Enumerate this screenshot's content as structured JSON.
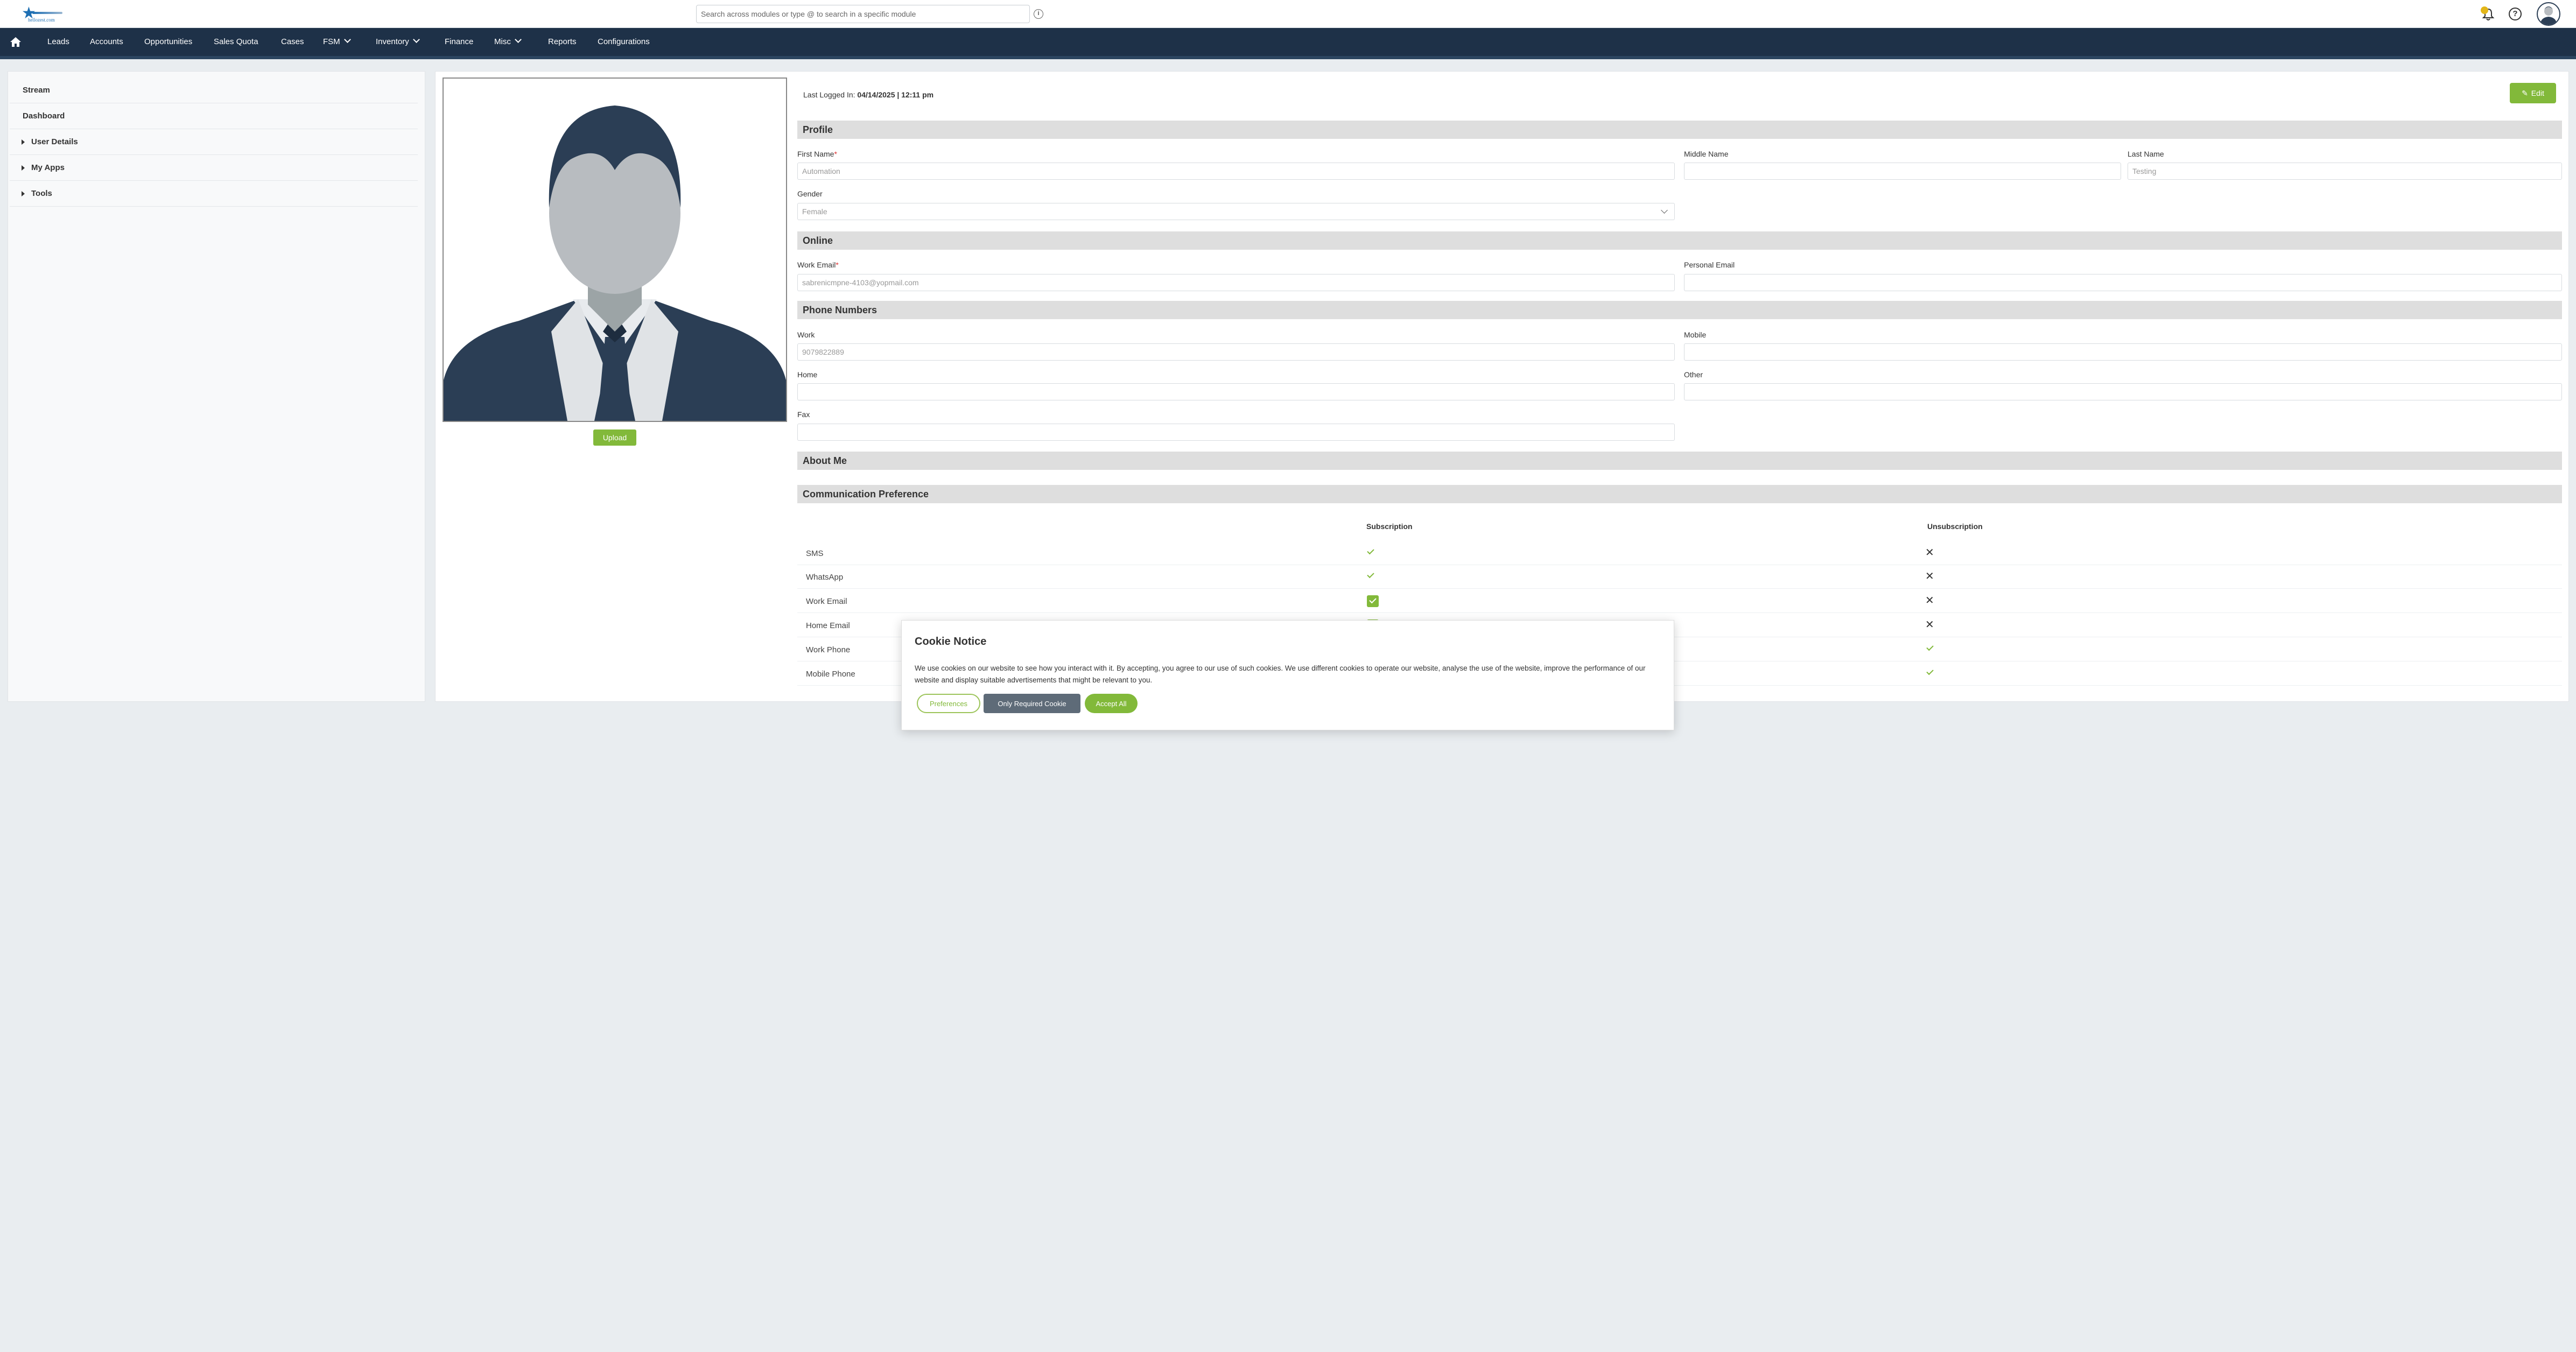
{
  "topbar": {
    "logo_text": "hellozest.com",
    "search_placeholder": "Search across modules or type @ to search in a specific module"
  },
  "nav": {
    "items": [
      {
        "label": "Leads",
        "dropdown": false
      },
      {
        "label": "Accounts",
        "dropdown": false
      },
      {
        "label": "Opportunities",
        "dropdown": false
      },
      {
        "label": "Sales Quota",
        "dropdown": false
      },
      {
        "label": "Cases",
        "dropdown": false
      },
      {
        "label": "FSM",
        "dropdown": true
      },
      {
        "label": "Inventory",
        "dropdown": true
      },
      {
        "label": "Finance",
        "dropdown": false
      },
      {
        "label": "Misc",
        "dropdown": true
      },
      {
        "label": "Reports",
        "dropdown": false
      },
      {
        "label": "Configurations",
        "dropdown": false
      }
    ]
  },
  "sidebar": {
    "items": [
      {
        "label": "Stream",
        "expandable": false
      },
      {
        "label": "Dashboard",
        "expandable": false
      },
      {
        "label": "User Details",
        "expandable": true
      },
      {
        "label": "My Apps",
        "expandable": true
      },
      {
        "label": "Tools",
        "expandable": true
      }
    ]
  },
  "profile_photo": {
    "upload_label": "Upload"
  },
  "header": {
    "last_logged_label": "Last Logged In:",
    "last_logged_value": "04/14/2025 | 12:11 pm",
    "edit_label": "Edit"
  },
  "sections": {
    "profile": "Profile",
    "online": "Online",
    "phone": "Phone Numbers",
    "about": "About Me",
    "comm": "Communication Preference"
  },
  "fields": {
    "first_name": {
      "label": "First Name",
      "value": "Automation"
    },
    "middle_name": {
      "label": "Middle Name",
      "value": ""
    },
    "last_name": {
      "label": "Last Name",
      "value": "Testing"
    },
    "gender": {
      "label": "Gender",
      "value": "Female"
    },
    "work_email": {
      "label": "Work Email",
      "value": "sabrenicmpne-4103@yopmail.com"
    },
    "personal_email": {
      "label": "Personal Email",
      "value": ""
    },
    "work_phone": {
      "label": "Work",
      "value": "9079822889"
    },
    "mobile": {
      "label": "Mobile",
      "value": ""
    },
    "home": {
      "label": "Home",
      "value": ""
    },
    "other": {
      "label": "Other",
      "value": ""
    },
    "fax": {
      "label": "Fax",
      "value": ""
    }
  },
  "required_mark": "*",
  "comm_table": {
    "headers": {
      "subscription": "Subscription",
      "unsubscription": "Unsubscription"
    },
    "rows": [
      {
        "label": "SMS",
        "subscription": "check",
        "unsubscription": "x"
      },
      {
        "label": "WhatsApp",
        "subscription": "check",
        "unsubscription": "x"
      },
      {
        "label": "Work Email",
        "subscription": "checkbox",
        "unsubscription": "x"
      },
      {
        "label": "Home Email",
        "subscription": "checkbox",
        "unsubscription": "x"
      },
      {
        "label": "Work Phone",
        "subscription": "",
        "unsubscription": "check"
      },
      {
        "label": "Mobile Phone",
        "subscription": "",
        "unsubscription": "check"
      }
    ]
  },
  "cookie": {
    "title": "Cookie Notice",
    "text": "We use cookies on our website to see how you interact with it. By accepting, you agree to our use of such cookies. We use different cookies to operate our website, analyse the use of the website, improve the performance of our website and display suitable advertisements that might be relevant to you.",
    "preferences": "Preferences",
    "only_required": "Only Required Cookie",
    "accept_all": "Accept All"
  },
  "colors": {
    "accent": "#82b93a",
    "nav": "#1e3148",
    "badge": "#e3b618"
  }
}
